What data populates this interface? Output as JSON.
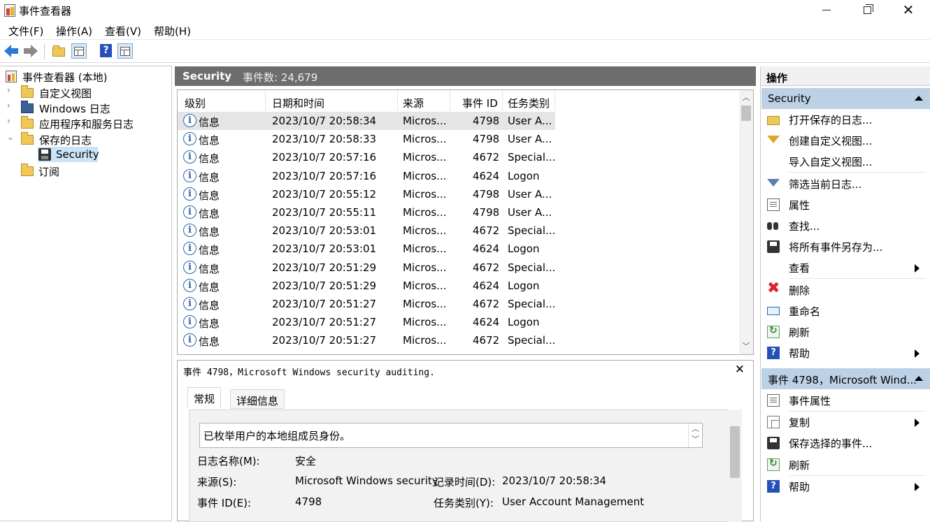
{
  "window": {
    "title": "事件查看器",
    "minimize_glyph": "",
    "close_glyph": "✕"
  },
  "menu": [
    "文件(F)",
    "操作(A)",
    "查看(V)",
    "帮助(H)"
  ],
  "toolbar": {
    "icons": [
      "back-arrow-icon",
      "forward-arrow-icon",
      "up-folder-icon",
      "show-tree-icon",
      "help-icon",
      "show-action-pane-icon"
    ],
    "help_glyph": "?"
  },
  "tree": {
    "root": "事件查看器 (本地)",
    "items": [
      {
        "label": "自定义视图",
        "expandable": true
      },
      {
        "label": "Windows 日志",
        "expandable": true
      },
      {
        "label": "应用程序和服务日志",
        "expandable": true
      },
      {
        "label": "保存的日志",
        "expanded": true
      }
    ],
    "saved_child": "Security",
    "subscriptions": "订阅",
    "chev_collapsed": "›",
    "chev_expanded": "⌄"
  },
  "log_header": {
    "name": "Security",
    "count": "事件数: 24,679"
  },
  "columns": [
    "级别",
    "日期和时间",
    "来源",
    "事件 ID",
    "任务类别"
  ],
  "events": [
    {
      "level": "信息",
      "datetime": "2023/10/7 20:58:34",
      "source": "Micros...",
      "id": "4798",
      "category": "User A..."
    },
    {
      "level": "信息",
      "datetime": "2023/10/7 20:58:33",
      "source": "Micros...",
      "id": "4798",
      "category": "User A..."
    },
    {
      "level": "信息",
      "datetime": "2023/10/7 20:57:16",
      "source": "Micros...",
      "id": "4672",
      "category": "Special..."
    },
    {
      "level": "信息",
      "datetime": "2023/10/7 20:57:16",
      "source": "Micros...",
      "id": "4624",
      "category": "Logon"
    },
    {
      "level": "信息",
      "datetime": "2023/10/7 20:55:12",
      "source": "Micros...",
      "id": "4798",
      "category": "User A..."
    },
    {
      "level": "信息",
      "datetime": "2023/10/7 20:55:11",
      "source": "Micros...",
      "id": "4798",
      "category": "User A..."
    },
    {
      "level": "信息",
      "datetime": "2023/10/7 20:53:01",
      "source": "Micros...",
      "id": "4672",
      "category": "Special..."
    },
    {
      "level": "信息",
      "datetime": "2023/10/7 20:53:01",
      "source": "Micros...",
      "id": "4624",
      "category": "Logon"
    },
    {
      "level": "信息",
      "datetime": "2023/10/7 20:51:29",
      "source": "Micros...",
      "id": "4672",
      "category": "Special..."
    },
    {
      "level": "信息",
      "datetime": "2023/10/7 20:51:29",
      "source": "Micros...",
      "id": "4624",
      "category": "Logon"
    },
    {
      "level": "信息",
      "datetime": "2023/10/7 20:51:27",
      "source": "Micros...",
      "id": "4672",
      "category": "Special..."
    },
    {
      "level": "信息",
      "datetime": "2023/10/7 20:51:27",
      "source": "Micros...",
      "id": "4624",
      "category": "Logon"
    },
    {
      "level": "信息",
      "datetime": "2023/10/7 20:51:27",
      "source": "Micros...",
      "id": "4672",
      "category": "Special..."
    }
  ],
  "detail": {
    "title": "事件 4798，Microsoft Windows security auditing.",
    "close_glyph": "✕",
    "tabs": [
      "常规",
      "详细信息"
    ],
    "description": "已枚举用户的本地组成员身份。",
    "fields": {
      "log_name_label": "日志名称(M):",
      "log_name_value": "安全",
      "source_label": "来源(S):",
      "source_value": "Microsoft Windows security",
      "logged_label": "记录时间(D):",
      "logged_value": "2023/10/7 20:58:34",
      "event_id_label": "事件 ID(E):",
      "event_id_value": "4798",
      "task_label": "任务类别(Y):",
      "task_value": "User Account Management"
    }
  },
  "actions": {
    "title": "操作",
    "section1": "Security",
    "items1": [
      {
        "label": "打开保存的日志...",
        "icon": "open-folder-icon"
      },
      {
        "label": "创建自定义视图...",
        "icon": "create-filter-icon"
      },
      {
        "label": "导入自定义视图...",
        "icon": ""
      },
      {
        "label": "筛选当前日志...",
        "icon": "filter-icon"
      },
      {
        "label": "属性",
        "icon": "properties-icon"
      },
      {
        "label": "查找...",
        "icon": "find-binoculars-icon"
      },
      {
        "label": "将所有事件另存为...",
        "icon": "save-icon"
      },
      {
        "label": "查看",
        "icon": "",
        "submenu": true
      },
      {
        "label": "删除",
        "icon": "delete-icon"
      },
      {
        "label": "重命名",
        "icon": "rename-icon"
      },
      {
        "label": "刷新",
        "icon": "refresh-icon"
      },
      {
        "label": "帮助",
        "icon": "help-icon",
        "submenu": true
      }
    ],
    "section2": "事件 4798，Microsoft Wind...",
    "items2": [
      {
        "label": "事件属性",
        "icon": "event-properties-icon"
      },
      {
        "label": "复制",
        "icon": "copy-icon",
        "submenu": true
      },
      {
        "label": "保存选择的事件...",
        "icon": "save-icon"
      },
      {
        "label": "刷新",
        "icon": "refresh-icon"
      },
      {
        "label": "帮助",
        "icon": "help-icon",
        "submenu": true
      }
    ]
  }
}
